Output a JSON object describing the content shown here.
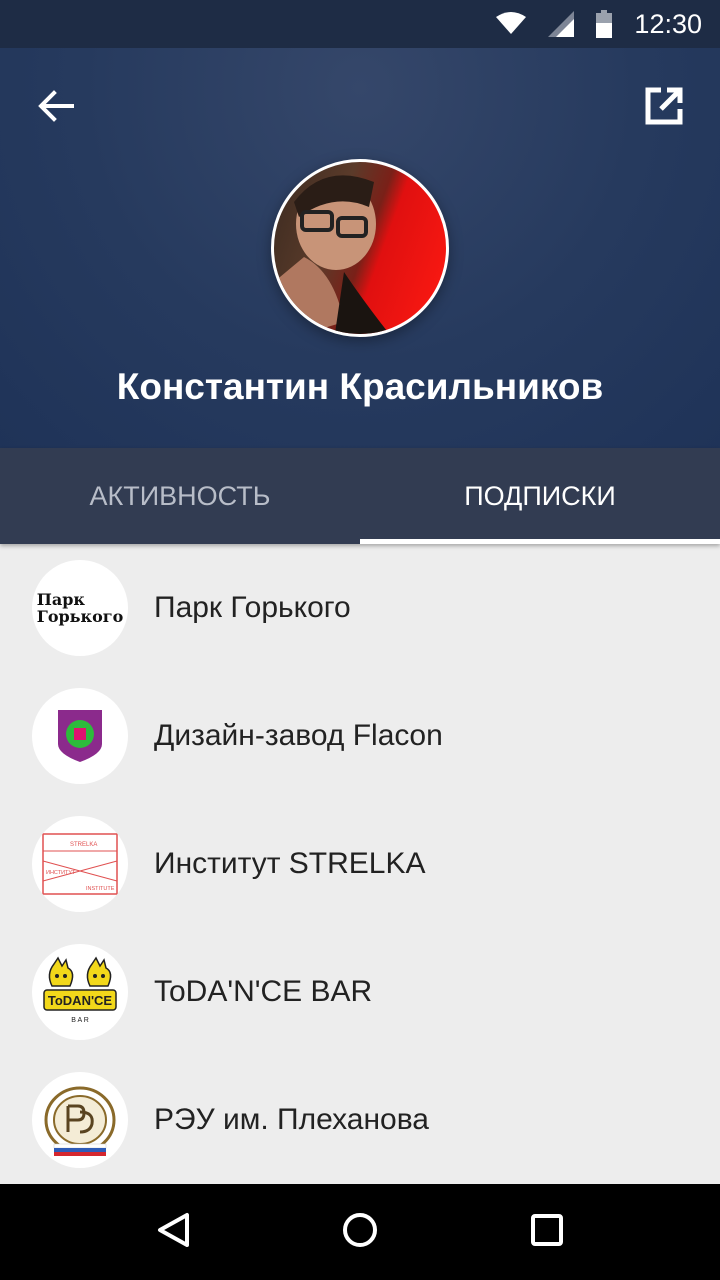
{
  "status_bar": {
    "time": "12:30"
  },
  "header": {
    "profile_name": "Константин Красильников"
  },
  "tabs": [
    {
      "label": "АКТИВНОСТЬ",
      "active": false
    },
    {
      "label": "ПОДПИСКИ",
      "active": true
    }
  ],
  "subscriptions": [
    {
      "name": "Парк Горького",
      "logo_text": [
        "Парк",
        "Горького"
      ]
    },
    {
      "name": "Дизайн-завод Flacon"
    },
    {
      "name": "Институт STRELKA",
      "logo_text": [
        "STRELKA",
        "ИНСТИТУТ",
        "INSTITUTE"
      ]
    },
    {
      "name": "ToDA'N'CE BAR",
      "logo_text": [
        "ToDAN'CE",
        "B A R"
      ]
    },
    {
      "name": "РЭУ им. Плеханова"
    }
  ],
  "colors": {
    "header_bg": "#263a5e",
    "tabs_bg": "#323c52",
    "list_bg": "#ededed"
  },
  "icons": {
    "back": "arrow-back-icon",
    "share": "open-external-icon",
    "wifi": "wifi-icon",
    "signal": "signal-icon",
    "battery": "battery-icon",
    "nav_back": "nav-back-icon",
    "nav_home": "nav-home-icon",
    "nav_recents": "nav-recents-icon"
  }
}
